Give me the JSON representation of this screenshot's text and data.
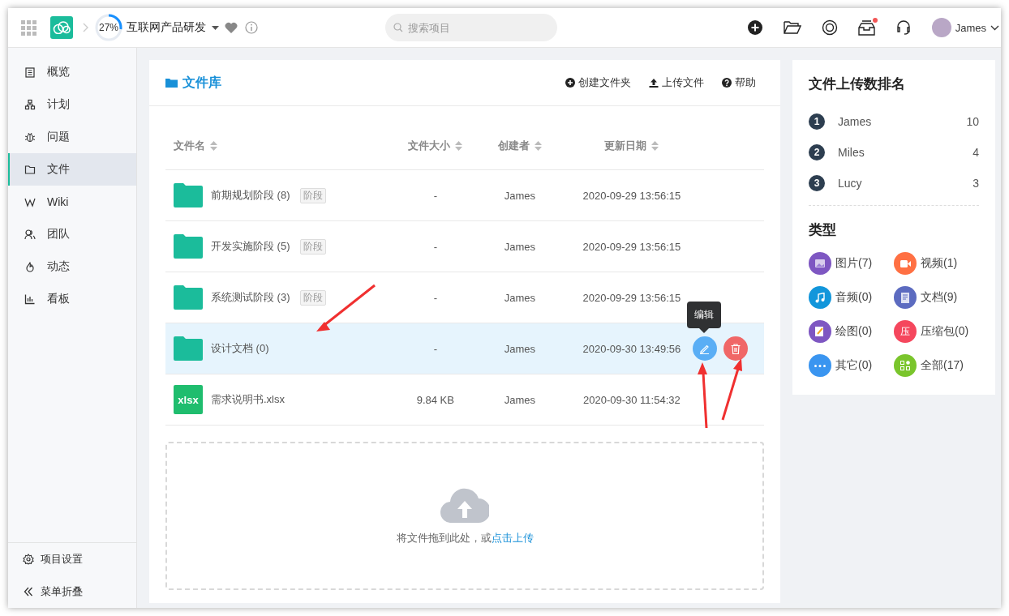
{
  "topbar": {
    "progress": {
      "level": 0.27,
      "text": "27%"
    },
    "project": "互联网产品研发",
    "search": {
      "placeholder": "搜索项目"
    },
    "notification_dot": true,
    "user": "James"
  },
  "sidebar": {
    "items": [
      {
        "kind": "overview",
        "label": "概览",
        "selected": false
      },
      {
        "kind": "plan",
        "label": "计划",
        "selected": false
      },
      {
        "kind": "bug",
        "label": "问题",
        "selected": false
      },
      {
        "kind": "folder",
        "label": "文件",
        "selected": true
      },
      {
        "kind": "wiki",
        "label": "Wiki",
        "selected": false
      },
      {
        "kind": "team",
        "label": "团队",
        "selected": false
      },
      {
        "kind": "fire",
        "label": "动态",
        "selected": false
      },
      {
        "kind": "chart",
        "label": "看板",
        "selected": false
      }
    ],
    "footer": [
      {
        "kind": "gear",
        "label": "项目设置"
      },
      {
        "kind": "collapse",
        "label": "菜单折叠"
      }
    ]
  },
  "library": {
    "title": "文件库",
    "actions": [
      {
        "kind": "plus",
        "label": "创建文件夹"
      },
      {
        "kind": "upload",
        "label": "上传文件"
      },
      {
        "kind": "help",
        "label": "帮助"
      }
    ],
    "columns": [
      "文件名",
      "文件大小",
      "创建者",
      "更新日期"
    ],
    "rows": [
      {
        "kind": "folder",
        "name": "前期规划阶段 (8)",
        "tag": "阶段",
        "size": "-",
        "creator": "James",
        "date": "2020-09-29 13:56:15",
        "selected": false
      },
      {
        "kind": "folder",
        "name": "开发实施阶段 (5)",
        "tag": "阶段",
        "size": "-",
        "creator": "James",
        "date": "2020-09-29 13:56:15",
        "selected": false
      },
      {
        "kind": "folder",
        "name": "系统测试阶段 (3)",
        "tag": "阶段",
        "size": "-",
        "creator": "James",
        "date": "2020-09-29 13:56:15",
        "selected": false
      },
      {
        "kind": "folder",
        "name": "设计文档 (0)",
        "size": "-",
        "creator": "James",
        "date": "2020-09-30 13:49:56",
        "selected": true,
        "tooltip": "编辑"
      },
      {
        "kind": "xlsx",
        "icon_text": "xlsx",
        "name": "需求说明书.xlsx",
        "size": "9.84 KB",
        "creator": "James",
        "date": "2020-09-30 11:54:32",
        "selected": false
      }
    ],
    "dropzone": {
      "text": "将文件拖到此处，或",
      "link": "点击上传"
    }
  },
  "ranking": {
    "title": "文件上传数排名",
    "items": [
      {
        "rank": "1",
        "name": "James",
        "count": "10"
      },
      {
        "rank": "2",
        "name": "Miles",
        "count": "4"
      },
      {
        "rank": "3",
        "name": "Lucy",
        "count": "3"
      }
    ]
  },
  "types": {
    "title": "类型",
    "items": [
      {
        "kind": "image",
        "label": "图片(7)",
        "color": "#7e57c2"
      },
      {
        "kind": "video",
        "label": "视频(1)",
        "color": "#ff7043"
      },
      {
        "kind": "audio",
        "label": "音频(0)",
        "color": "#1296db"
      },
      {
        "kind": "doc",
        "label": "文档(9)",
        "color": "#5c6bc0"
      },
      {
        "kind": "draw",
        "label": "绘图(0)",
        "color": "#7e57c2"
      },
      {
        "kind": "glyph",
        "glyph": "压",
        "label": "压缩包(0)",
        "color": "#f5475d"
      },
      {
        "kind": "more",
        "label": "其它(0)",
        "color": "#3a95f0"
      },
      {
        "kind": "all",
        "label": "全部(17)",
        "color": "#7ac52c"
      }
    ]
  }
}
